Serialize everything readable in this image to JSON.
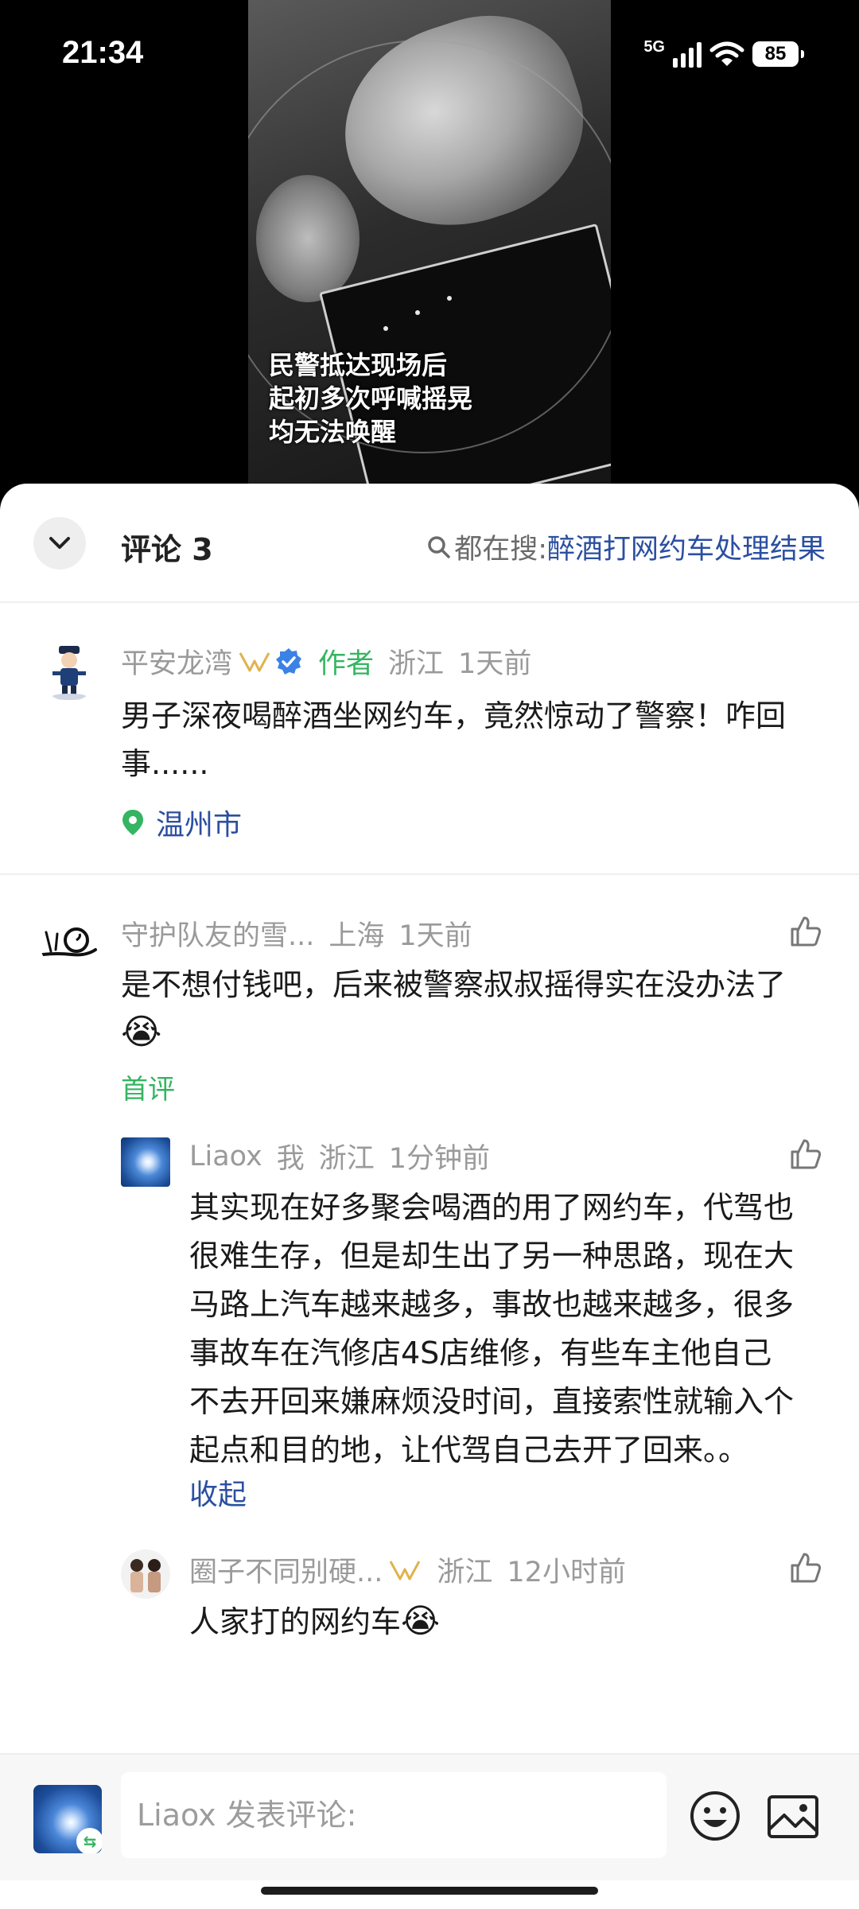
{
  "status_bar": {
    "time": "21:34",
    "network": "5G",
    "battery": "85",
    "icons": [
      "signal-icon",
      "wifi-icon",
      "battery-icon"
    ]
  },
  "video": {
    "caption_lines": [
      "民警抵达现场后",
      "起初多次呼喊摇晃",
      "均无法唤醒"
    ]
  },
  "comments_header": {
    "title": "评论 3",
    "search_prefix": "都在搜:",
    "search_term": "醉酒打网约车处理结果"
  },
  "author_post": {
    "user": "平安龙湾",
    "author_tag": "作者",
    "region": "浙江",
    "time": "1天前",
    "text": "男子深夜喝醉酒坐网约车，竟然惊动了警察！咋回事......",
    "location": "温州市"
  },
  "comments": [
    {
      "user": "守护队友的雪...",
      "region": "上海",
      "time": "1天前",
      "text": "是不想付钱吧，后来被警察叔叔摇得实在没办法了",
      "emoji": "😭",
      "badge": "首评"
    }
  ],
  "replies": [
    {
      "user": "Liaox",
      "me_tag": "我",
      "region": "浙江",
      "time": "1分钟前",
      "text_lines": [
        "其实现在好多聚会喝酒的用了网约车，代驾也",
        "很难生存，但是却生出了另一种思路，现在大",
        "马路上汽车越来越多，事故也越来越多，很多",
        "事故车在汽修店4S店维修，有些车主他自己",
        "不去开回来嫌麻烦没时间，直接索性就输入个",
        "起点和目的地，让代驾自己去开了回来。。"
      ],
      "collapse_label": "收起"
    },
    {
      "user": "圈子不同别硬...",
      "region": "浙江",
      "time": "12小时前",
      "text": "人家打的网约车",
      "emoji": "😭"
    }
  ],
  "input_bar": {
    "placeholder": "Liaox 发表评论:"
  },
  "colors": {
    "accent_green": "#35b561",
    "link_blue": "#2b4fa0",
    "meta_gray": "#9a9a9a"
  }
}
